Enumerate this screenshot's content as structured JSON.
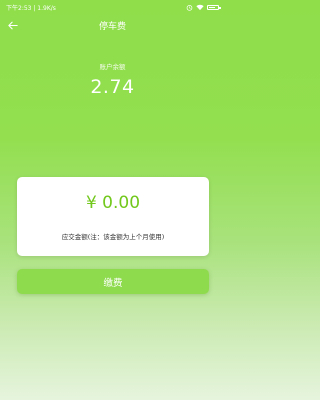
{
  "status_bar": {
    "time_speed": "下午2:53 | 1.9K/s",
    "icons": [
      "alarm-icon",
      "wifi-icon",
      "battery-icon"
    ],
    "battery_level": 0.8
  },
  "nav": {
    "back_icon": "back-arrow-icon",
    "title": "停车费"
  },
  "account": {
    "balance_label": "账户余额",
    "balance_value": "2.74"
  },
  "payment": {
    "amount": "¥ 0.00",
    "note": "应交金额(注：该金额为上个月使用)",
    "button_label": "缴费"
  },
  "colors": {
    "accent_green": "#72c81c",
    "button_green": "#8fdb4e",
    "background_top": "#8fde4a",
    "background_bottom": "#e6f4dd"
  }
}
